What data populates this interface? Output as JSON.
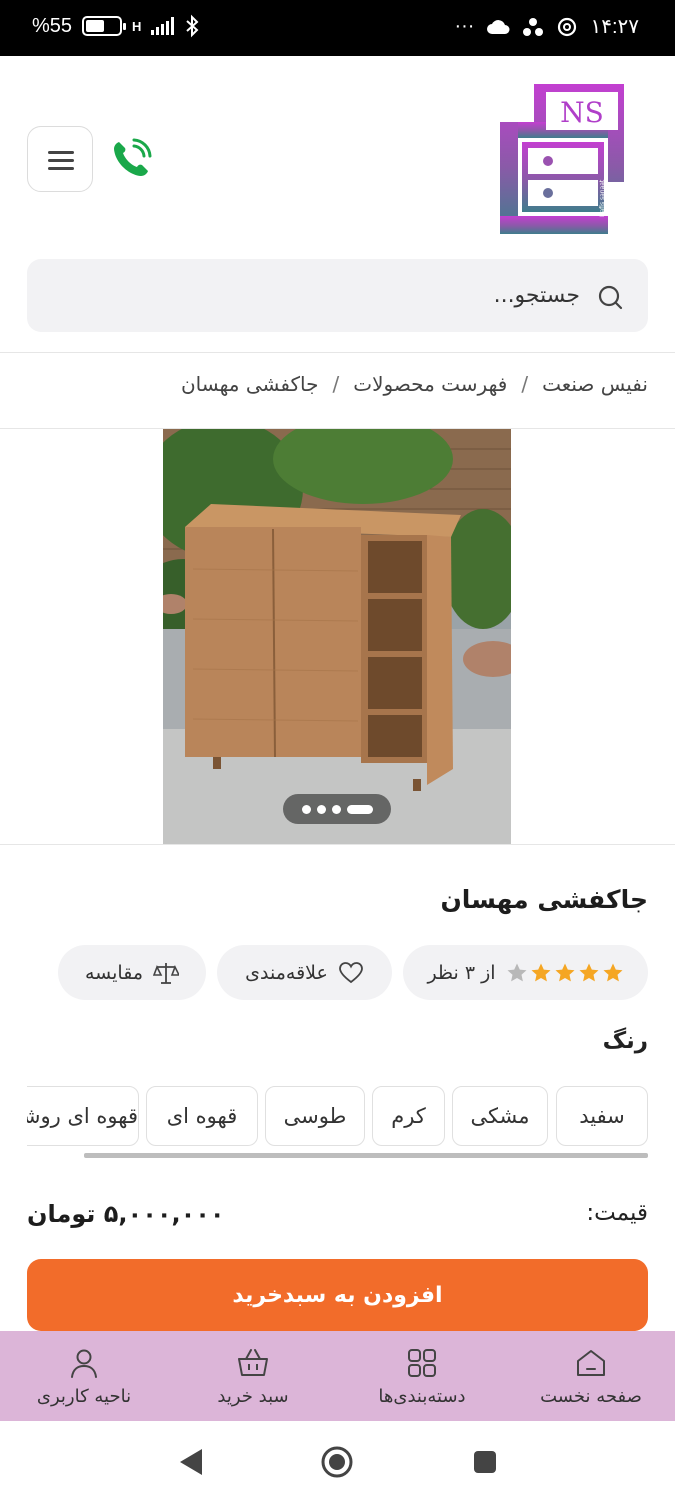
{
  "status_bar": {
    "battery": "55",
    "battery_suffix": "%",
    "battery_level": 0.55,
    "network": "H",
    "time": "۱۴:۲۷",
    "more": "···"
  },
  "header": {
    "logo_text": "NS",
    "logo_caption": "Nafis sanaat",
    "menu_icon": "hamburger-icon",
    "phone_icon": "phone-icon"
  },
  "search": {
    "placeholder": "جستجو..."
  },
  "breadcrumb": [
    "نفیس صنعت",
    "فهرست محصولات",
    "جاکفشی مهسان"
  ],
  "breadcrumb_sep": "/",
  "product": {
    "title": "جاکفشی مهسان",
    "rating": 4,
    "rating_max": 5,
    "reviews_text": "از ۳ نظر",
    "wishlist_label": "علاقه‌مندی",
    "compare_label": "مقایسه",
    "color_title": "رنگ",
    "colors": [
      "سفید",
      "مشکی",
      "کرم",
      "طوسی",
      "قهوه ای",
      "قهوه ای روشن"
    ],
    "price_label": "قیمت:",
    "price_value": "۵,۰۰۰,۰۰۰ تومان",
    "add_to_cart": "افزودن به سبدخرید",
    "image_count": 4,
    "image_active": 1
  },
  "bottom_nav": {
    "home": "صفحه نخست",
    "categories": "دسته‌بندی‌ها",
    "cart": "سبد خرید",
    "account": "ناحیه کاربری"
  },
  "colors": {
    "accent": "#f26c2a",
    "nav_bg": "#dcb5d8",
    "star": "#f5a623",
    "logo_purple": "#b03fc9",
    "logo_teal": "#3f7d8c"
  }
}
